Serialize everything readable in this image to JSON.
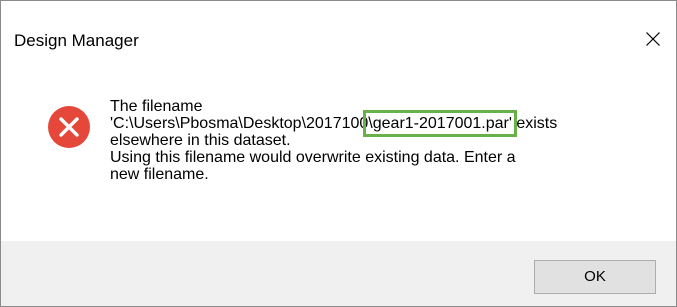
{
  "window": {
    "title": "Design Manager",
    "close_icon": "close-icon"
  },
  "message": {
    "icon": "error-x-icon",
    "icon_color": "#e5483a",
    "line1": "The filename",
    "line2_prefix": "'C:\\Users\\Pbosma\\Desktop\\2017100",
    "line2_highlight": "\\gear1-2017001.par'",
    "line2_suffix": " exists",
    "line3": "elsewhere in this dataset.",
    "line4": "Using this filename would overwrite existing data.  Enter a",
    "line5": "new filename.",
    "highlight_color": "#6ab04a"
  },
  "buttons": {
    "ok_label": "OK"
  }
}
